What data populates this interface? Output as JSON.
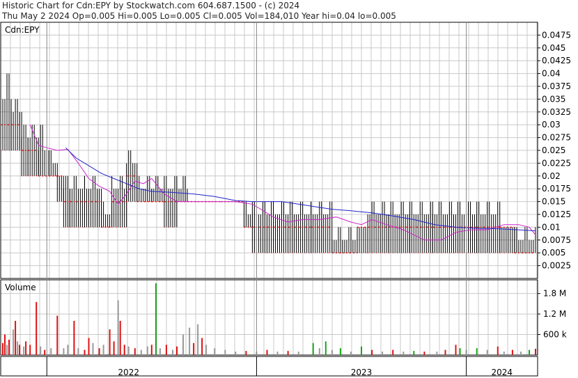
{
  "header": {
    "line1": "Historic Chart for Cdn:EPY by Stockwatch.com 604.687.1500 - (c) 2024",
    "line2": "Thu May  2 2024  Op=0.005  Hi=0.005  Lo=0.005  Cl=0.005  Vol=184,010  Year hi=0.04  lo=0.005"
  },
  "colors": {
    "up_volume": "#1aa31a",
    "down_volume": "#dd1111",
    "flat_volume": "#999999",
    "price_bar": "#000000",
    "close_tick": "#dd1111",
    "ma_short": "#cc22cc",
    "ma_long": "#2222cc",
    "grid": "#c8c8c8"
  },
  "chart_data": [
    {
      "type": "line",
      "title": "Cdn:EPY",
      "ylim": [
        0,
        0.05
      ],
      "yticks": [
        "0.0475",
        "0.045",
        "0.0425",
        "0.04",
        "0.0375",
        "0.035",
        "0.0325",
        "0.03",
        "0.0275",
        "0.025",
        "0.0225",
        "0.02",
        "0.0175",
        "0.015",
        "0.0125",
        "0.01",
        "0.0075",
        "0.005",
        "0.0025"
      ],
      "ytick_values": [
        0.0475,
        0.045,
        0.0425,
        0.04,
        0.0375,
        0.035,
        0.0325,
        0.03,
        0.0275,
        0.025,
        0.0225,
        0.02,
        0.0175,
        0.015,
        0.0125,
        0.01,
        0.0075,
        0.005,
        0.0025
      ],
      "x_labels": [
        "2022",
        "2023",
        "2024"
      ],
      "x_years": [
        2022,
        2023,
        2024
      ],
      "x_range": [
        2021.78,
        2024.34
      ],
      "price_segments": [
        {
          "x": [
            2021.78,
            2021.83
          ],
          "lo": 0.025,
          "hi": 0.04,
          "close": 0.03
        },
        {
          "x": [
            2021.83,
            2021.88
          ],
          "lo": 0.025,
          "hi": 0.035,
          "close": 0.03
        },
        {
          "x": [
            2021.88,
            2021.91
          ],
          "lo": 0.02,
          "hi": 0.03,
          "close": 0.025
        },
        {
          "x": [
            2021.91,
            2021.96
          ],
          "lo": 0.02,
          "hi": 0.03,
          "close": 0.025
        },
        {
          "x": [
            2021.96,
            2022.01
          ],
          "lo": 0.02,
          "hi": 0.03,
          "close": 0.02
        },
        {
          "x": [
            2022.01,
            2022.05
          ],
          "lo": 0.02,
          "hi": 0.025,
          "close": 0.02
        },
        {
          "x": [
            2022.05,
            2022.08
          ],
          "lo": 0.015,
          "hi": 0.02,
          "close": 0.02
        },
        {
          "x": [
            2022.08,
            2022.11
          ],
          "lo": 0.01,
          "hi": 0.02,
          "close": 0.015
        },
        {
          "x": [
            2022.11,
            2022.18
          ],
          "lo": 0.01,
          "hi": 0.02,
          "close": 0.015
        },
        {
          "x": [
            2022.18,
            2022.26
          ],
          "lo": 0.01,
          "hi": 0.02,
          "close": 0.015
        },
        {
          "x": [
            2022.26,
            2022.31
          ],
          "lo": 0.01,
          "hi": 0.015,
          "close": 0.01
        },
        {
          "x": [
            2022.31,
            2022.38
          ],
          "lo": 0.01,
          "hi": 0.02,
          "close": 0.015
        },
        {
          "x": [
            2022.38,
            2022.43
          ],
          "lo": 0.015,
          "hi": 0.025,
          "close": 0.02
        },
        {
          "x": [
            2022.43,
            2022.5
          ],
          "lo": 0.015,
          "hi": 0.02,
          "close": 0.015
        },
        {
          "x": [
            2022.5,
            2022.56
          ],
          "lo": 0.015,
          "hi": 0.02,
          "close": 0.015
        },
        {
          "x": [
            2022.56,
            2022.62
          ],
          "lo": 0.01,
          "hi": 0.02,
          "close": 0.015
        },
        {
          "x": [
            2022.62,
            2022.67
          ],
          "lo": 0.015,
          "hi": 0.02,
          "close": 0.015
        },
        {
          "x": [
            2022.67,
            2022.72
          ],
          "lo": 0.015,
          "hi": 0.015,
          "close": 0.015
        },
        {
          "x": [
            2022.72,
            2022.83
          ],
          "lo": 0.015,
          "hi": 0.015,
          "close": 0.015
        },
        {
          "x": [
            2022.83,
            2022.94
          ],
          "lo": 0.015,
          "hi": 0.015,
          "close": 0.015
        },
        {
          "x": [
            2022.94,
            2022.98
          ],
          "lo": 0.01,
          "hi": 0.015,
          "close": 0.01
        },
        {
          "x": [
            2022.98,
            2023.05
          ],
          "lo": 0.005,
          "hi": 0.015,
          "close": 0.01
        },
        {
          "x": [
            2023.05,
            2023.15
          ],
          "lo": 0.005,
          "hi": 0.015,
          "close": 0.01
        },
        {
          "x": [
            2023.15,
            2023.26
          ],
          "lo": 0.005,
          "hi": 0.015,
          "close": 0.01
        },
        {
          "x": [
            2023.26,
            2023.36
          ],
          "lo": 0.005,
          "hi": 0.015,
          "close": 0.01
        },
        {
          "x": [
            2023.36,
            2023.48
          ],
          "lo": 0.005,
          "hi": 0.01,
          "close": 0.005
        },
        {
          "x": [
            2023.48,
            2023.53
          ],
          "lo": 0.005,
          "hi": 0.01,
          "close": 0.01
        },
        {
          "x": [
            2023.53,
            2023.63
          ],
          "lo": 0.005,
          "hi": 0.015,
          "close": 0.01
        },
        {
          "x": [
            2023.63,
            2023.73
          ],
          "lo": 0.005,
          "hi": 0.015,
          "close": 0.01
        },
        {
          "x": [
            2023.73,
            2023.84
          ],
          "lo": 0.005,
          "hi": 0.015,
          "close": 0.01
        },
        {
          "x": [
            2023.84,
            2023.94
          ],
          "lo": 0.005,
          "hi": 0.015,
          "close": 0.01
        },
        {
          "x": [
            2023.94,
            2024.05
          ],
          "lo": 0.005,
          "hi": 0.015,
          "close": 0.01
        },
        {
          "x": [
            2024.05,
            2024.16
          ],
          "lo": 0.005,
          "hi": 0.015,
          "close": 0.01
        },
        {
          "x": [
            2024.16,
            2024.23
          ],
          "lo": 0.005,
          "hi": 0.01,
          "close": 0.01
        },
        {
          "x": [
            2024.23,
            2024.33
          ],
          "lo": 0.005,
          "hi": 0.01,
          "close": 0.005
        }
      ],
      "series": [
        {
          "role": "ma_short",
          "x": [
            2021.92,
            2021.96,
            2022.0,
            2022.05,
            2022.1,
            2022.15,
            2022.2,
            2022.25,
            2022.3,
            2022.34,
            2022.38,
            2022.42,
            2022.46,
            2022.5,
            2022.56,
            2022.62,
            2022.7,
            2022.8,
            2022.9,
            2022.98,
            2023.02,
            2023.08,
            2023.15,
            2023.22,
            2023.3,
            2023.38,
            2023.45,
            2023.5,
            2023.55,
            2023.62,
            2023.7,
            2023.8,
            2023.88,
            2023.95,
            2024.02,
            2024.1,
            2024.18,
            2024.25,
            2024.3,
            2024.33
          ],
          "y": [
            0.03,
            0.026,
            0.0255,
            0.025,
            0.0252,
            0.0225,
            0.0195,
            0.018,
            0.017,
            0.0145,
            0.0165,
            0.019,
            0.0185,
            0.0195,
            0.0165,
            0.015,
            0.015,
            0.015,
            0.015,
            0.0145,
            0.0135,
            0.012,
            0.011,
            0.0115,
            0.0115,
            0.012,
            0.011,
            0.0105,
            0.0115,
            0.0105,
            0.0095,
            0.0075,
            0.0075,
            0.009,
            0.0095,
            0.0095,
            0.0105,
            0.0105,
            0.01,
            0.0085
          ]
        },
        {
          "role": "ma_long",
          "x": [
            2022.09,
            2022.14,
            2022.2,
            2022.26,
            2022.32,
            2022.38,
            2022.44,
            2022.5,
            2022.6,
            2022.7,
            2022.8,
            2022.9,
            2022.98,
            2023.05,
            2023.12,
            2023.2,
            2023.28,
            2023.36,
            2023.45,
            2023.55,
            2023.65,
            2023.75,
            2023.85,
            2023.95,
            2024.05,
            2024.15,
            2024.25,
            2024.33
          ],
          "y": [
            0.0255,
            0.0235,
            0.022,
            0.0205,
            0.0195,
            0.0185,
            0.0175,
            0.017,
            0.0168,
            0.0165,
            0.016,
            0.0152,
            0.015,
            0.015,
            0.015,
            0.0145,
            0.014,
            0.0135,
            0.0132,
            0.0128,
            0.0122,
            0.0115,
            0.0105,
            0.01,
            0.0098,
            0.0097,
            0.0095,
            0.0093
          ]
        }
      ]
    },
    {
      "type": "bar",
      "title": "Volume",
      "ylim": [
        0,
        2200000
      ],
      "yticks": [
        "1.8 M",
        "1.2 M",
        "600 k"
      ],
      "ytick_values": [
        1800000,
        1200000,
        600000
      ],
      "x_range": [
        2021.78,
        2024.34
      ],
      "bars": [
        {
          "x": 2021.79,
          "v": 350000,
          "c": "down"
        },
        {
          "x": 2021.8,
          "v": 600000,
          "c": "down"
        },
        {
          "x": 2021.81,
          "v": 300000,
          "c": "flat"
        },
        {
          "x": 2021.82,
          "v": 450000,
          "c": "down"
        },
        {
          "x": 2021.84,
          "v": 750000,
          "c": "flat"
        },
        {
          "x": 2021.85,
          "v": 1000000,
          "c": "down"
        },
        {
          "x": 2021.86,
          "v": 400000,
          "c": "flat"
        },
        {
          "x": 2021.87,
          "v": 300000,
          "c": "down"
        },
        {
          "x": 2021.89,
          "v": 250000,
          "c": "flat"
        },
        {
          "x": 2021.9,
          "v": 400000,
          "c": "down"
        },
        {
          "x": 2021.92,
          "v": 300000,
          "c": "down"
        },
        {
          "x": 2021.95,
          "v": 1550000,
          "c": "down"
        },
        {
          "x": 2021.97,
          "v": 250000,
          "c": "flat"
        },
        {
          "x": 2021.99,
          "v": 150000,
          "c": "down"
        },
        {
          "x": 2022.02,
          "v": 200000,
          "c": "flat"
        },
        {
          "x": 2022.05,
          "v": 1150000,
          "c": "down"
        },
        {
          "x": 2022.08,
          "v": 200000,
          "c": "flat"
        },
        {
          "x": 2022.1,
          "v": 300000,
          "c": "flat"
        },
        {
          "x": 2022.13,
          "v": 1000000,
          "c": "down"
        },
        {
          "x": 2022.15,
          "v": 200000,
          "c": "flat"
        },
        {
          "x": 2022.18,
          "v": 150000,
          "c": "down"
        },
        {
          "x": 2022.2,
          "v": 500000,
          "c": "down"
        },
        {
          "x": 2022.22,
          "v": 350000,
          "c": "flat"
        },
        {
          "x": 2022.25,
          "v": 200000,
          "c": "down"
        },
        {
          "x": 2022.27,
          "v": 300000,
          "c": "flat"
        },
        {
          "x": 2022.3,
          "v": 750000,
          "c": "down"
        },
        {
          "x": 2022.32,
          "v": 400000,
          "c": "down"
        },
        {
          "x": 2022.34,
          "v": 1600000,
          "c": "flat"
        },
        {
          "x": 2022.35,
          "v": 1000000,
          "c": "down"
        },
        {
          "x": 2022.37,
          "v": 300000,
          "c": "down"
        },
        {
          "x": 2022.39,
          "v": 250000,
          "c": "flat"
        },
        {
          "x": 2022.42,
          "v": 200000,
          "c": "down"
        },
        {
          "x": 2022.45,
          "v": 150000,
          "c": "flat"
        },
        {
          "x": 2022.48,
          "v": 250000,
          "c": "flat"
        },
        {
          "x": 2022.5,
          "v": 300000,
          "c": "down"
        },
        {
          "x": 2022.52,
          "v": 2100000,
          "c": "up"
        },
        {
          "x": 2022.54,
          "v": 200000,
          "c": "flat"
        },
        {
          "x": 2022.57,
          "v": 300000,
          "c": "down"
        },
        {
          "x": 2022.6,
          "v": 150000,
          "c": "flat"
        },
        {
          "x": 2022.62,
          "v": 250000,
          "c": "down"
        },
        {
          "x": 2022.65,
          "v": 600000,
          "c": "flat"
        },
        {
          "x": 2022.68,
          "v": 800000,
          "c": "flat"
        },
        {
          "x": 2022.7,
          "v": 350000,
          "c": "down"
        },
        {
          "x": 2022.72,
          "v": 900000,
          "c": "flat"
        },
        {
          "x": 2022.74,
          "v": 500000,
          "c": "down"
        },
        {
          "x": 2022.76,
          "v": 300000,
          "c": "flat"
        },
        {
          "x": 2022.8,
          "v": 200000,
          "c": "flat"
        },
        {
          "x": 2022.85,
          "v": 150000,
          "c": "flat"
        },
        {
          "x": 2022.9,
          "v": 100000,
          "c": "flat"
        },
        {
          "x": 2022.95,
          "v": 120000,
          "c": "down"
        },
        {
          "x": 2023.0,
          "v": 100000,
          "c": "flat"
        },
        {
          "x": 2023.05,
          "v": 150000,
          "c": "down"
        },
        {
          "x": 2023.1,
          "v": 100000,
          "c": "flat"
        },
        {
          "x": 2023.15,
          "v": 120000,
          "c": "down"
        },
        {
          "x": 2023.2,
          "v": 100000,
          "c": "flat"
        },
        {
          "x": 2023.27,
          "v": 350000,
          "c": "up"
        },
        {
          "x": 2023.3,
          "v": 200000,
          "c": "flat"
        },
        {
          "x": 2023.33,
          "v": 400000,
          "c": "up"
        },
        {
          "x": 2023.36,
          "v": 150000,
          "c": "flat"
        },
        {
          "x": 2023.4,
          "v": 200000,
          "c": "up"
        },
        {
          "x": 2023.45,
          "v": 100000,
          "c": "flat"
        },
        {
          "x": 2023.5,
          "v": 250000,
          "c": "up"
        },
        {
          "x": 2023.55,
          "v": 150000,
          "c": "down"
        },
        {
          "x": 2023.6,
          "v": 100000,
          "c": "flat"
        },
        {
          "x": 2023.65,
          "v": 150000,
          "c": "down"
        },
        {
          "x": 2023.7,
          "v": 100000,
          "c": "flat"
        },
        {
          "x": 2023.75,
          "v": 120000,
          "c": "up"
        },
        {
          "x": 2023.8,
          "v": 100000,
          "c": "down"
        },
        {
          "x": 2023.86,
          "v": 100000,
          "c": "flat"
        },
        {
          "x": 2023.9,
          "v": 150000,
          "c": "down"
        },
        {
          "x": 2023.95,
          "v": 300000,
          "c": "down"
        },
        {
          "x": 2023.97,
          "v": 200000,
          "c": "up"
        },
        {
          "x": 2024.0,
          "v": 150000,
          "c": "flat"
        },
        {
          "x": 2024.05,
          "v": 200000,
          "c": "up"
        },
        {
          "x": 2024.1,
          "v": 150000,
          "c": "flat"
        },
        {
          "x": 2024.15,
          "v": 250000,
          "c": "down"
        },
        {
          "x": 2024.18,
          "v": 100000,
          "c": "flat"
        },
        {
          "x": 2024.22,
          "v": 150000,
          "c": "down"
        },
        {
          "x": 2024.26,
          "v": 100000,
          "c": "flat"
        },
        {
          "x": 2024.3,
          "v": 150000,
          "c": "up"
        },
        {
          "x": 2024.33,
          "v": 184010,
          "c": "down"
        }
      ]
    }
  ]
}
